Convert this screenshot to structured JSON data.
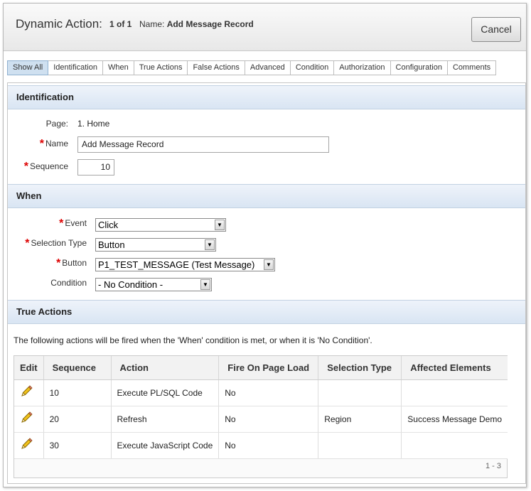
{
  "header": {
    "title": "Dynamic Action:",
    "count": "1 of 1",
    "name_label": "Name:",
    "name_value": "Add Message Record",
    "cancel_label": "Cancel"
  },
  "tabs": [
    {
      "label": "Show All",
      "active": true
    },
    {
      "label": "Identification"
    },
    {
      "label": "When"
    },
    {
      "label": "True Actions"
    },
    {
      "label": "False Actions"
    },
    {
      "label": "Advanced"
    },
    {
      "label": "Condition"
    },
    {
      "label": "Authorization"
    },
    {
      "label": "Configuration"
    },
    {
      "label": "Comments"
    }
  ],
  "identification": {
    "heading": "Identification",
    "page_label": "Page:",
    "page_value": "1. Home",
    "name_label": "Name",
    "name_value": "Add Message Record",
    "sequence_label": "Sequence",
    "sequence_value": "10"
  },
  "when": {
    "heading": "When",
    "event_label": "Event",
    "event_value": "Click",
    "selection_type_label": "Selection Type",
    "selection_type_value": "Button",
    "button_label": "Button",
    "button_value": "P1_TEST_MESSAGE (Test Message)",
    "condition_label": "Condition",
    "condition_value": "- No Condition -"
  },
  "true_actions": {
    "heading": "True Actions",
    "description": "The following actions will be fired when the 'When' condition is met, or when it is 'No Condition'.",
    "columns": [
      "Edit",
      "Sequence",
      "Action",
      "Fire On Page Load",
      "Selection Type",
      "Affected Elements"
    ],
    "rows": [
      {
        "sequence": "10",
        "action": "Execute PL/SQL Code",
        "fire_on_load": "No",
        "selection_type": "",
        "affected": ""
      },
      {
        "sequence": "20",
        "action": "Refresh",
        "fire_on_load": "No",
        "selection_type": "Region",
        "affected": "Success Message Demo"
      },
      {
        "sequence": "30",
        "action": "Execute JavaScript Code",
        "fire_on_load": "No",
        "selection_type": "",
        "affected": ""
      }
    ],
    "pagination": "1 - 3",
    "edit_icon": "pencil-icon"
  },
  "colors": {
    "required": "#dd0000",
    "region_header": "#d9e5f3",
    "active_tab": "#cfe0f0"
  }
}
